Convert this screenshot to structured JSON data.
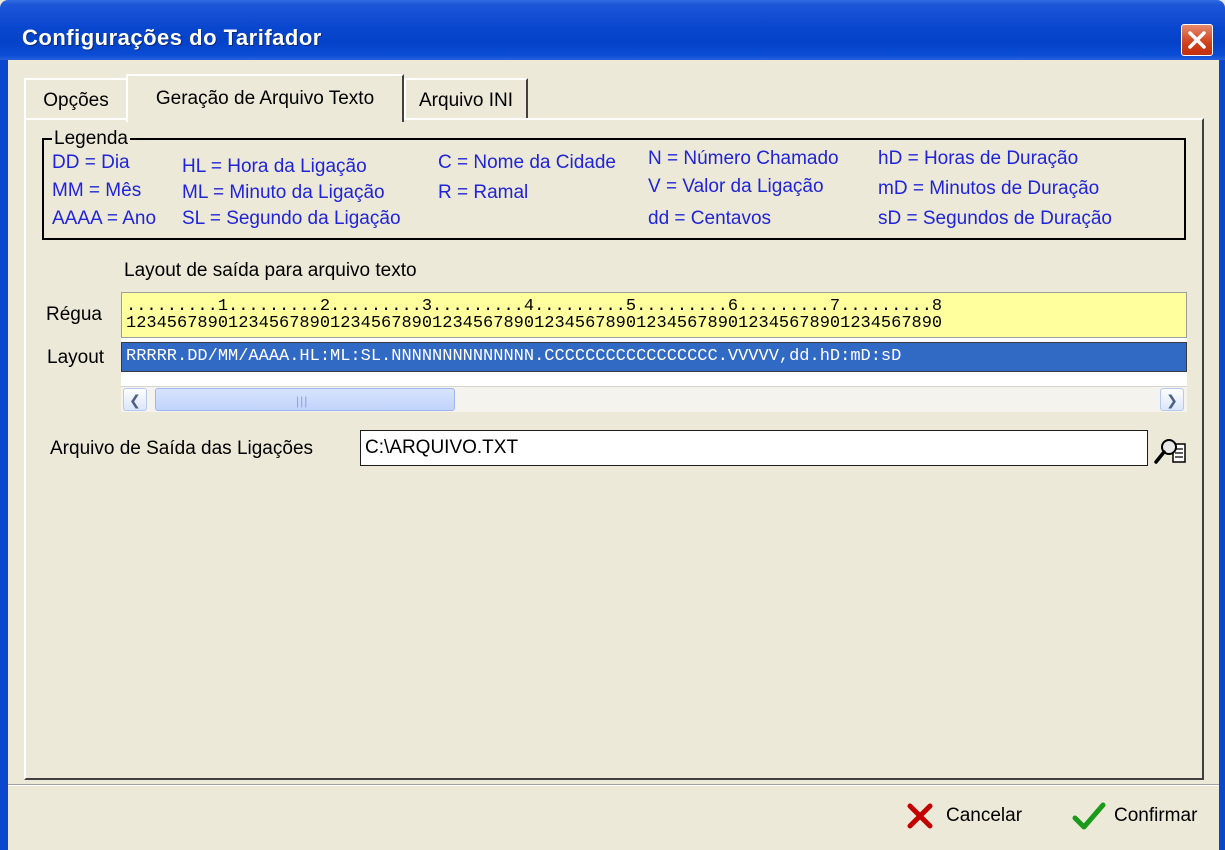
{
  "window": {
    "title": "Configurações do Tarifador"
  },
  "tabs": [
    {
      "label": "Opções"
    },
    {
      "label": "Geração de Arquivo Texto"
    },
    {
      "label": "Arquivo INI"
    }
  ],
  "legend": {
    "title": "Legenda",
    "items": [
      "DD = Dia",
      "MM = Mês",
      "AAAA = Ano",
      "HL = Hora da Ligação",
      "ML = Minuto da Ligação",
      "SL = Segundo da Ligação",
      "C = Nome da Cidade",
      "R = Ramal",
      "N = Número Chamado",
      "V = Valor da Ligação",
      "dd = Centavos",
      "hD = Horas de Duração",
      "mD = Minutos de Duração",
      "sD = Segundos de Duração"
    ]
  },
  "layout_section": {
    "caption": "Layout de saída para arquivo texto",
    "ruler_label": "Régua",
    "layout_label": "Layout",
    "ruler_line1": ".........1.........2.........3.........4.........5.........6.........7.........8",
    "ruler_line2": "12345678901234567890123456789012345678901234567890123456789012345678901234567890",
    "layout_value": "RRRRR.DD/MM/AAAA.HL:ML:SL.NNNNNNNNNNNNNN.CCCCCCCCCCCCCCCCC.VVVVV,dd.hD:mD:sD"
  },
  "output_file": {
    "label": "Arquivo de Saída das Ligações",
    "value": "C:\\ARQUIVO.TXT"
  },
  "buttons": {
    "cancel": "Cancelar",
    "confirm": "Confirmar"
  }
}
